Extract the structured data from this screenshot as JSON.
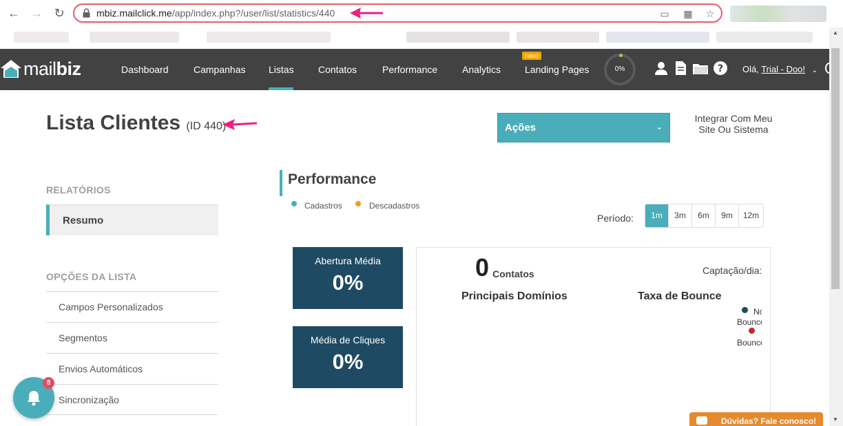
{
  "browser": {
    "url_host": "mbiz.mailclick.me",
    "url_path": "/app/index.php?/user/list/statistics/440"
  },
  "navbar": {
    "logo": "mailbiz",
    "items": [
      {
        "label": "Dashboard"
      },
      {
        "label": "Campanhas"
      },
      {
        "label": "Listas"
      },
      {
        "label": "Contatos"
      },
      {
        "label": "Performance"
      },
      {
        "label": "Analytics"
      },
      {
        "label": "Landing Pages"
      }
    ],
    "new_badge": "novo",
    "gauge_value": "0%",
    "greeting_prefix": "Olá, ",
    "greeting_name": "Trial - Doo!"
  },
  "header": {
    "title": "Lista Clientes",
    "id_label": "(ID 440)",
    "actions_label": "Ações",
    "integrate_label": "Integrar Com Meu Site Ou Sistema"
  },
  "sidebar": {
    "reports_heading": "RELATÓRIOS",
    "reports_items": [
      {
        "label": "Resumo",
        "active": true
      }
    ],
    "options_heading": "OPÇÕES DA LISTA",
    "options_items": [
      {
        "label": "Campos Personalizados"
      },
      {
        "label": "Segmentos"
      },
      {
        "label": "Envios Automáticos"
      },
      {
        "label": "Sincronização"
      }
    ]
  },
  "performance": {
    "title": "Performance",
    "legend": [
      {
        "label": "Cadastros",
        "color": "#4aaeba"
      },
      {
        "label": "Descadastros",
        "color": "#f0a020"
      }
    ],
    "period_label": "Período:",
    "periods": [
      "1m",
      "3m",
      "6m",
      "9m",
      "12m"
    ],
    "active_period": "1m",
    "open_rate_label": "Abertura Média",
    "open_rate_value": "0%",
    "click_rate_label": "Média de Cliques",
    "click_rate_value": "0%"
  },
  "panel": {
    "contacts_value": "0",
    "contacts_label": "Contatos",
    "capture_label": "Captação/dia:",
    "domains_label": "Principais Domínios",
    "bounce_label": "Taxa de Bounce",
    "bounce_legend_1a": "Nó",
    "bounce_legend_1b": "Bounce",
    "bounce_legend_2": "Bounce",
    "bounce_color_1": "#1e4a63",
    "bounce_color_2": "#d0202a"
  },
  "notifications": {
    "count": "8"
  },
  "help": {
    "label": "Dúvidas? Fale conosco!"
  }
}
